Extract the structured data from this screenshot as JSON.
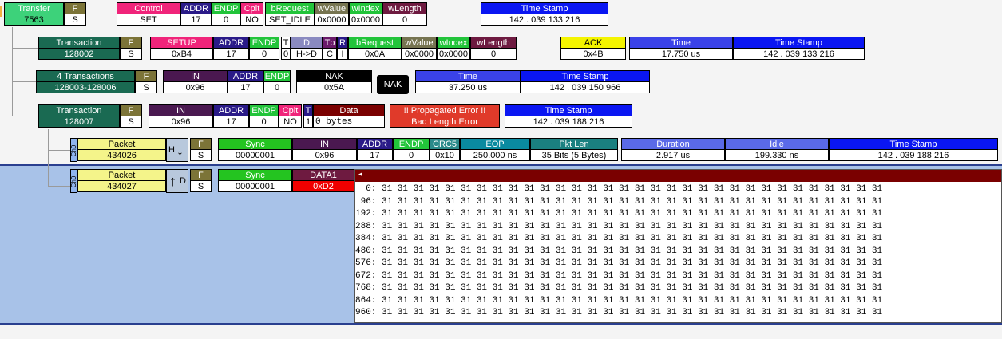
{
  "colors": {
    "transfer_bg": "#3dd27a",
    "f_bg": "#7c7438",
    "s_bg": "#ffffff",
    "control_bg": "#f0247a",
    "addr_bg": "#2a1a88",
    "endp_bg": "#22c43a",
    "cplt_bg": "#f0247a",
    "brequest_bg": "#22c43a",
    "wvalue_bg": "#767450",
    "windex_bg": "#22c43a",
    "wlength_bg": "#6e1a40",
    "timestamp_bg": "#0a16f2",
    "transaction_bg": "#1a6a52",
    "setup_bg": "#f0247a",
    "t_bg": "#ffffff",
    "d_bg": "#8a8ac0",
    "tp_bg": "#6a1a6a",
    "r_bg": "#2a1a88",
    "ack_bg": "#f4f400",
    "time_bg": "#3a42e8",
    "in_bg": "#4a1850",
    "nak_bg": "#000000",
    "data_bg": "#7a0000",
    "err_bg": "#e03a2a",
    "packet_bg": "#f4f48a",
    "sync_bg": "#24c420",
    "crc5_bg": "#2a8a8a",
    "eop_bg": "#0a8aa0",
    "pktlen_bg": "#1a8080",
    "duration_bg": "#5a6ae8",
    "idle_bg": "#5a6ae8",
    "data1_bg": "#6e1a40",
    "data1_val_bg": "#f00000",
    "selection_bg": "#a8c2e8"
  },
  "transfer": {
    "title": "Transfer",
    "id": "7563",
    "f_label": "F",
    "f_value": "S",
    "control_label": "Control",
    "control_value": "SET",
    "addr_label": "ADDR",
    "addr_value": "17",
    "endp_label": "ENDP",
    "endp_value": "0",
    "cplt_label": "Cplt",
    "cplt_value": "NO",
    "brequest_label": "bRequest",
    "brequest_value": "SET_IDLE",
    "wvalue_label": "wValue",
    "wvalue_value": "0x0000",
    "windex_label": "wIndex",
    "windex_value": "0x0000",
    "wlength_label": "wLength",
    "wlength_value": "0",
    "timestamp_label": "Time Stamp",
    "timestamp_value": "142 . 039 133 216"
  },
  "transaction1": {
    "title": "Transaction",
    "id": "128002",
    "f_label": "F",
    "f_value": "S",
    "setup_label": "SETUP",
    "setup_value": "0xB4",
    "addr_label": "ADDR",
    "addr_value": "17",
    "endp_label": "ENDP",
    "endp_value": "0",
    "t_label": "T",
    "t_value": "0",
    "d_label": "D",
    "d_value": "H->D",
    "tp_label": "Tp",
    "tp_value": "C",
    "r_label": "R",
    "r_value": "I",
    "brequest_label": "bRequest",
    "brequest_value": "0x0A",
    "wvalue_label": "wValue",
    "wvalue_value": "0x0000",
    "windex_label": "wIndex",
    "windex_value": "0x0000",
    "wlength_label": "wLength",
    "wlength_value": "0",
    "ack_label": "ACK",
    "ack_value": "0x4B",
    "time_label": "Time",
    "time_value": "17.750 us",
    "timestamp_label": "Time Stamp",
    "timestamp_value": "142 . 039 133 216"
  },
  "transaction2": {
    "title": "4 Transactions",
    "id": "128003-128006",
    "f_label": "F",
    "f_value": "S",
    "in_label": "IN",
    "in_value": "0x96",
    "addr_label": "ADDR",
    "addr_value": "17",
    "endp_label": "ENDP",
    "endp_value": "0",
    "nak_label": "NAK",
    "nak_value": "0x5A",
    "nak_badge": "NAK",
    "time_label": "Time",
    "time_value": "37.250 us",
    "timestamp_label": "Time Stamp",
    "timestamp_value": "142 . 039 150 966"
  },
  "transaction3": {
    "title": "Transaction",
    "id": "128007",
    "f_label": "F",
    "f_value": "S",
    "in_label": "IN",
    "in_value": "0x96",
    "addr_label": "ADDR",
    "addr_value": "17",
    "endp_label": "ENDP",
    "endp_value": "0",
    "cplt_label": "Cplt",
    "cplt_value": "NO",
    "t_label": "T",
    "t_value": "1",
    "data_label": "Data",
    "data_value": "0 bytes",
    "error_label": "!! Propagated Error !!",
    "error_value": "Bad Length Error",
    "timestamp_label": "Time Stamp",
    "timestamp_value": "142 . 039 188 216"
  },
  "packet1": {
    "channel": "Ch0",
    "title": "Packet",
    "id": "434026",
    "dir_letter": "H",
    "dir_arrow": "↓",
    "f_label": "F",
    "f_value": "S",
    "sync_label": "Sync",
    "sync_value": "00000001",
    "in_label": "IN",
    "in_value": "0x96",
    "addr_label": "ADDR",
    "addr_value": "17",
    "endp_label": "ENDP",
    "endp_value": "0",
    "crc5_label": "CRC5",
    "crc5_value": "0x10",
    "eop_label": "EOP",
    "eop_value": "250.000 ns",
    "pktlen_label": "Pkt Len",
    "pktlen_value": "35 Bits (5 Bytes)",
    "duration_label": "Duration",
    "duration_value": "2.917 us",
    "idle_label": "Idle",
    "idle_value": "199.330 ns",
    "timestamp_label": "Time Stamp",
    "timestamp_value": "142 . 039 188 216"
  },
  "packet2": {
    "channel": "Ch0",
    "title": "Packet",
    "id": "434027",
    "dir_letter": "D",
    "dir_arrow": "↑",
    "f_label": "F",
    "f_value": "S",
    "sync_label": "Sync",
    "sync_value": "00000001",
    "data1_label": "DATA1",
    "data1_value": "0xD2"
  },
  "hexdump": {
    "lines": [
      "  0: 31 31 31 31 31 31 31 31 31 31 31 31 31 31 31 31 31 31 31 31 31 31 31 31 31 31 31 31 31 31 31 31",
      " 96: 31 31 31 31 31 31 31 31 31 31 31 31 31 31 31 31 31 31 31 31 31 31 31 31 31 31 31 31 31 31 31 31",
      "192: 31 31 31 31 31 31 31 31 31 31 31 31 31 31 31 31 31 31 31 31 31 31 31 31 31 31 31 31 31 31 31 31",
      "288: 31 31 31 31 31 31 31 31 31 31 31 31 31 31 31 31 31 31 31 31 31 31 31 31 31 31 31 31 31 31 31 31",
      "384: 31 31 31 31 31 31 31 31 31 31 31 31 31 31 31 31 31 31 31 31 31 31 31 31 31 31 31 31 31 31 31 31",
      "480: 31 31 31 31 31 31 31 31 31 31 31 31 31 31 31 31 31 31 31 31 31 31 31 31 31 31 31 31 31 31 31 31",
      "576: 31 31 31 31 31 31 31 31 31 31 31 31 31 31 31 31 31 31 31 31 31 31 31 31 31 31 31 31 31 31 31 31",
      "672: 31 31 31 31 31 31 31 31 31 31 31 31 31 31 31 31 31 31 31 31 31 31 31 31 31 31 31 31 31 31 31 31",
      "768: 31 31 31 31 31 31 31 31 31 31 31 31 31 31 31 31 31 31 31 31 31 31 31 31 31 31 31 31 31 31 31 31",
      "864: 31 31 31 31 31 31 31 31 31 31 31 31 31 31 31 31 31 31 31 31 31 31 31 31 31 31 31 31 31 31 31 31",
      "960: 31 31 31 31 31 31 31 31 31 31 31 31 31 31 31 31 31 31 31 31 31 31 31 31 31 31 31 31 31 31 31 31"
    ]
  }
}
